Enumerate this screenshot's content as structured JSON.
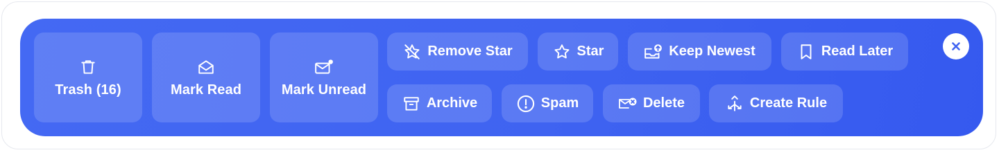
{
  "toolbar": {
    "tiles": [
      {
        "label": "Trash (16)",
        "icon": "trash-icon"
      },
      {
        "label": "Mark Read",
        "icon": "envelope-open-icon"
      },
      {
        "label": "Mark Unread",
        "icon": "envelope-unread-icon"
      }
    ],
    "row1": [
      {
        "label": "Remove Star",
        "icon": "star-off-icon"
      },
      {
        "label": "Star",
        "icon": "star-icon"
      },
      {
        "label": "Keep Newest",
        "icon": "inbox-upload-icon"
      },
      {
        "label": "Read Later",
        "icon": "bookmark-icon"
      }
    ],
    "row2": [
      {
        "label": "Archive",
        "icon": "archive-box-icon"
      },
      {
        "label": "Spam",
        "icon": "alert-circle-icon"
      },
      {
        "label": "Delete",
        "icon": "mail-delete-icon"
      },
      {
        "label": "Create Rule",
        "icon": "split-arrows-icon"
      }
    ],
    "close_icon": "close-icon"
  },
  "colors": {
    "bar": "#3f63f1",
    "button_fill": "rgba(255,255,255,0.15)",
    "text": "#ffffff",
    "close_bg": "#ffffff",
    "close_glyph": "#3f63f1"
  }
}
